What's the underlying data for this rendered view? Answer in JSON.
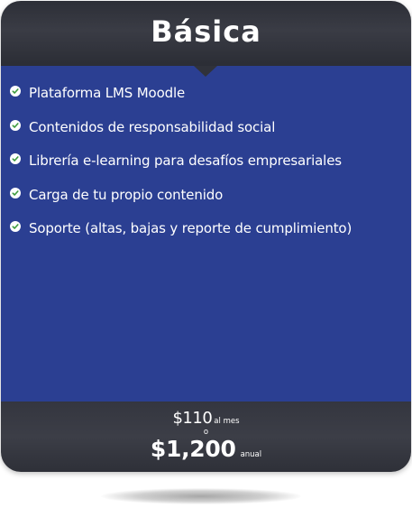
{
  "plan": {
    "title": "Básica",
    "features": [
      "Plataforma LMS Moodle",
      "Contenidos de responsabilidad social",
      "Librería e-learning para desafíos empresariales",
      "Carga de tu propio contenido",
      "Soporte (altas, bajas y reporte de cumplimiento)"
    ],
    "price_monthly": "$110",
    "price_monthly_label": "al mes",
    "or_text": "o",
    "price_annual": "$1,200",
    "price_annual_label": "anual"
  },
  "icons": {
    "feature_icon": "check-circle-icon"
  },
  "colors": {
    "header_bg": "#33353e",
    "body_bg": "#2b3f92",
    "footer_bg": "#36383f",
    "check_color": "#3c9a3a",
    "text": "#ffffff"
  }
}
